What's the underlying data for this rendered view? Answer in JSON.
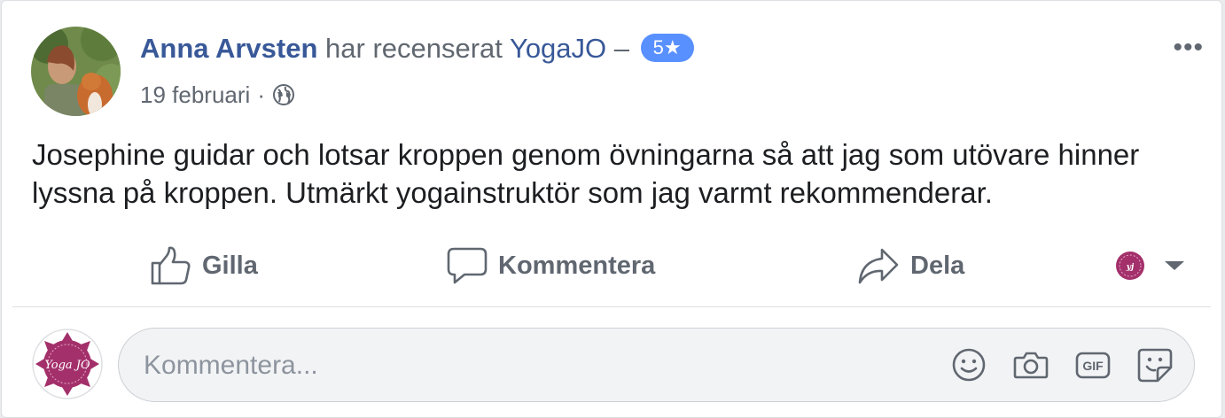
{
  "post": {
    "author": "Anna Arvsten",
    "action_text": "har recenserat",
    "page_name": "YogaJO",
    "dash": "–",
    "rating": "5★",
    "date": "19 februari",
    "separator": "·",
    "privacy_icon": "globe-icon",
    "more_label": "•••",
    "text": "Josephine guidar och lotsar kroppen genom övningarna så att jag som utövare hinner lyssna på kroppen. Utmärkt yogainstruktör som jag varmt rekommenderar."
  },
  "actions": {
    "like_label": "Gilla",
    "comment_label": "Kommentera",
    "share_label": "Dela"
  },
  "comment_box": {
    "placeholder": "Kommentera...",
    "icons": [
      "emoji-icon",
      "camera-icon",
      "gif-icon",
      "sticker-icon"
    ],
    "gif_text": "GIF"
  },
  "brand": {
    "logo_text": "Yoga JO",
    "logo_color": "#a3306b",
    "link_color": "#385898",
    "badge_color": "#5890ff"
  }
}
